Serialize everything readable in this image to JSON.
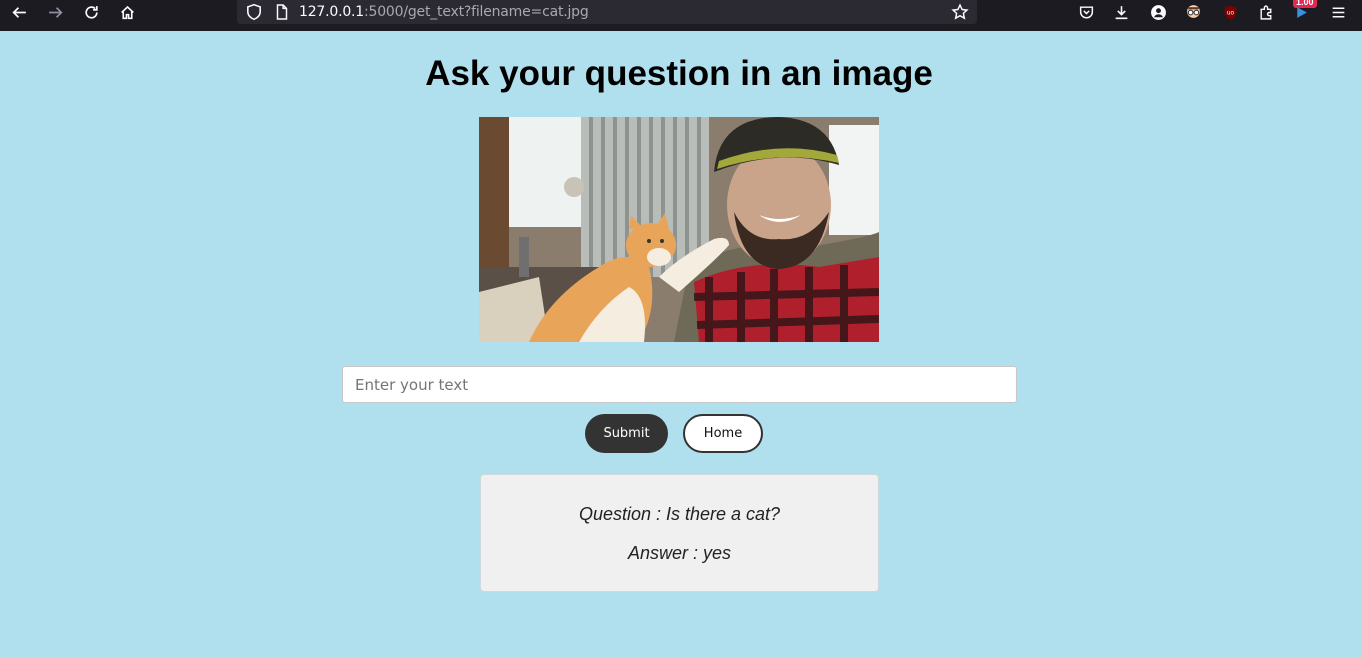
{
  "browser": {
    "url_host": "127.0.0.1",
    "url_path": ":5000/get_text?filename=cat.jpg",
    "extension_badge": "1.00"
  },
  "page": {
    "title": "Ask your question in an image"
  },
  "form": {
    "placeholder": "Enter your text",
    "value": "",
    "submit_label": "Submit",
    "home_label": "Home"
  },
  "result": {
    "question": "Question : Is there a cat?",
    "answer": "Answer : yes"
  },
  "colors": {
    "page_background": "#b0e0ee",
    "submit_button": "#333333",
    "result_box": "#f0f0f0"
  }
}
